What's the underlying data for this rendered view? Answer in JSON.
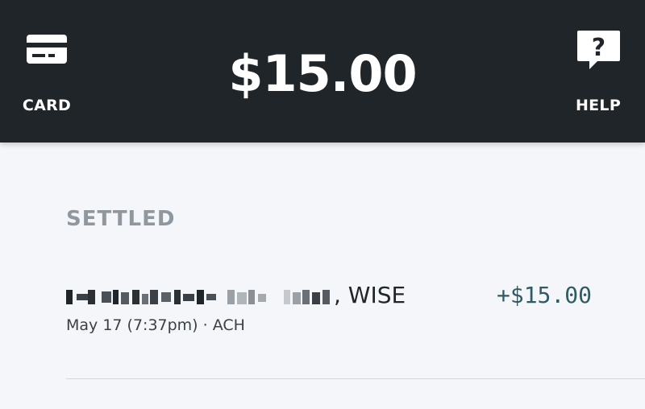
{
  "header": {
    "balance": "$15.00",
    "card_label": "CARD",
    "help_label": "HELP",
    "card_icon": "credit-card-icon",
    "help_icon": "question-bubble-icon",
    "background_color": "#1f2529"
  },
  "transactions": {
    "section_title": "SETTLED",
    "items": [
      {
        "name_suffix": ", WISE",
        "amount": "+$15.00",
        "meta": "May 17 (7:37pm) · ACH",
        "amount_color": "#2f5b63"
      }
    ]
  }
}
